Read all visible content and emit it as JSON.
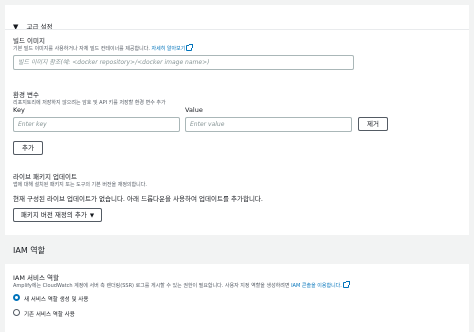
{
  "advanced": {
    "toggle_icon": "caret-down",
    "title": "고급 설정"
  },
  "build_image": {
    "label": "빌드 이미지",
    "description": "기본 빌드 이미지를 사용하거나 자체 빌드 컨테이너를 제공합니다.",
    "learn_more": "자세히 알아보기",
    "input_placeholder": "빌드 이미지 참조(예: <docker repository>/<docker image name>)"
  },
  "env_vars": {
    "label": "환경 변수",
    "description": "리포지토리에 저장하지 않으려는 암호 및 API 키를 저장할 환경 변수 추가",
    "key_header": "Key",
    "value_header": "Value",
    "key_placeholder": "Enter key",
    "value_placeholder": "Enter value",
    "remove_label": "제거",
    "add_label": "추가"
  },
  "package_updates": {
    "label": "라이브 패키지 업데이트",
    "description": "앱에 대해 설치된 패키지 또는 도구의 기본 버전을 재정의합니다.",
    "note": "현재 구성된 라이브 업데이트가 없습니다. 아래 드롭다운을 사용하여 업데이트를 추가합니다.",
    "dropdown_label": "패키지 버전 재정의 추가"
  },
  "iam": {
    "title": "IAM 역할",
    "service_role_label": "IAM 서비스 역할",
    "description": "Amplify에는 CloudWatch 계정에 서버 측 렌더링(SSR) 로그를 게시할 수 있는 권한이 필요합니다. 사용자 지정 역할을 생성하려면",
    "console_link": "IAM 콘솔을 이용합니다.",
    "options": [
      {
        "label": "새 서비스 역할 생성 및 사용",
        "selected": true
      },
      {
        "label": "기존 서비스 역할 사용",
        "selected": false
      }
    ]
  },
  "colors": {
    "link": "#0073bb",
    "text": "#16191f",
    "muted": "#545b64",
    "border": "#aab7b8",
    "background": "#f2f3f3"
  }
}
